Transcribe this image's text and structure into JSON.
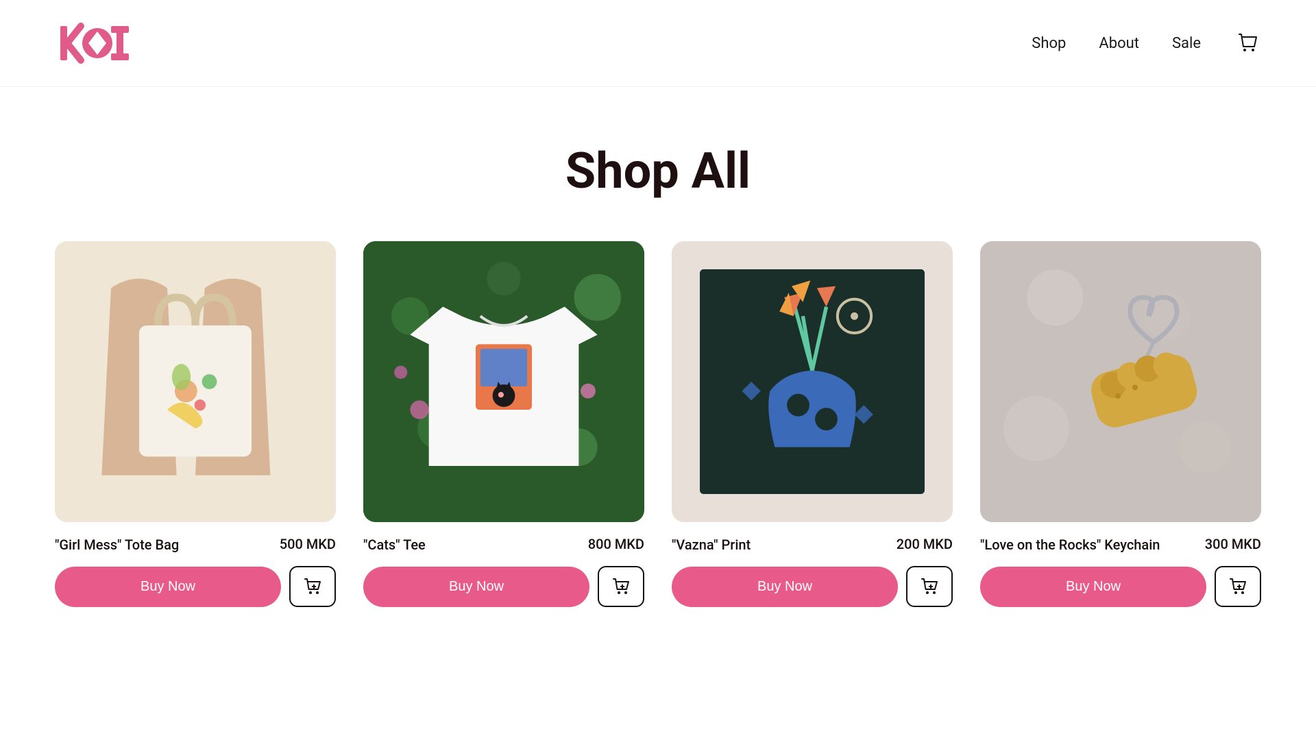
{
  "header": {
    "logo_alt": "KOI Logo",
    "nav": {
      "shop_label": "Shop",
      "about_label": "About",
      "sale_label": "Sale"
    },
    "cart_label": "Cart"
  },
  "page": {
    "title": "Shop All"
  },
  "products": [
    {
      "id": "tote-bag",
      "name": "\"Girl Mess\" Tote Bag",
      "price": "500 MKD",
      "image_style": "img-tote",
      "image_desc": "Tote bag on wooden chair with illustrated prints"
    },
    {
      "id": "cats-tee",
      "name": "\"Cats\" Tee",
      "price": "800 MKD",
      "image_style": "img-tee",
      "image_desc": "White t-shirt with cat illustration on flower bed"
    },
    {
      "id": "vazna-print",
      "name": "\"Vazna\" Print",
      "price": "200 MKD",
      "image_style": "img-print",
      "image_desc": "Dark illustrated print with vase and flowers"
    },
    {
      "id": "love-keychain",
      "name": "\"Love on the Rocks\" Keychain",
      "price": "300 MKD",
      "image_style": "img-keychain",
      "image_desc": "Yellow enamel hand keychain with heart ring"
    }
  ],
  "buttons": {
    "buy_now": "Buy Now"
  }
}
